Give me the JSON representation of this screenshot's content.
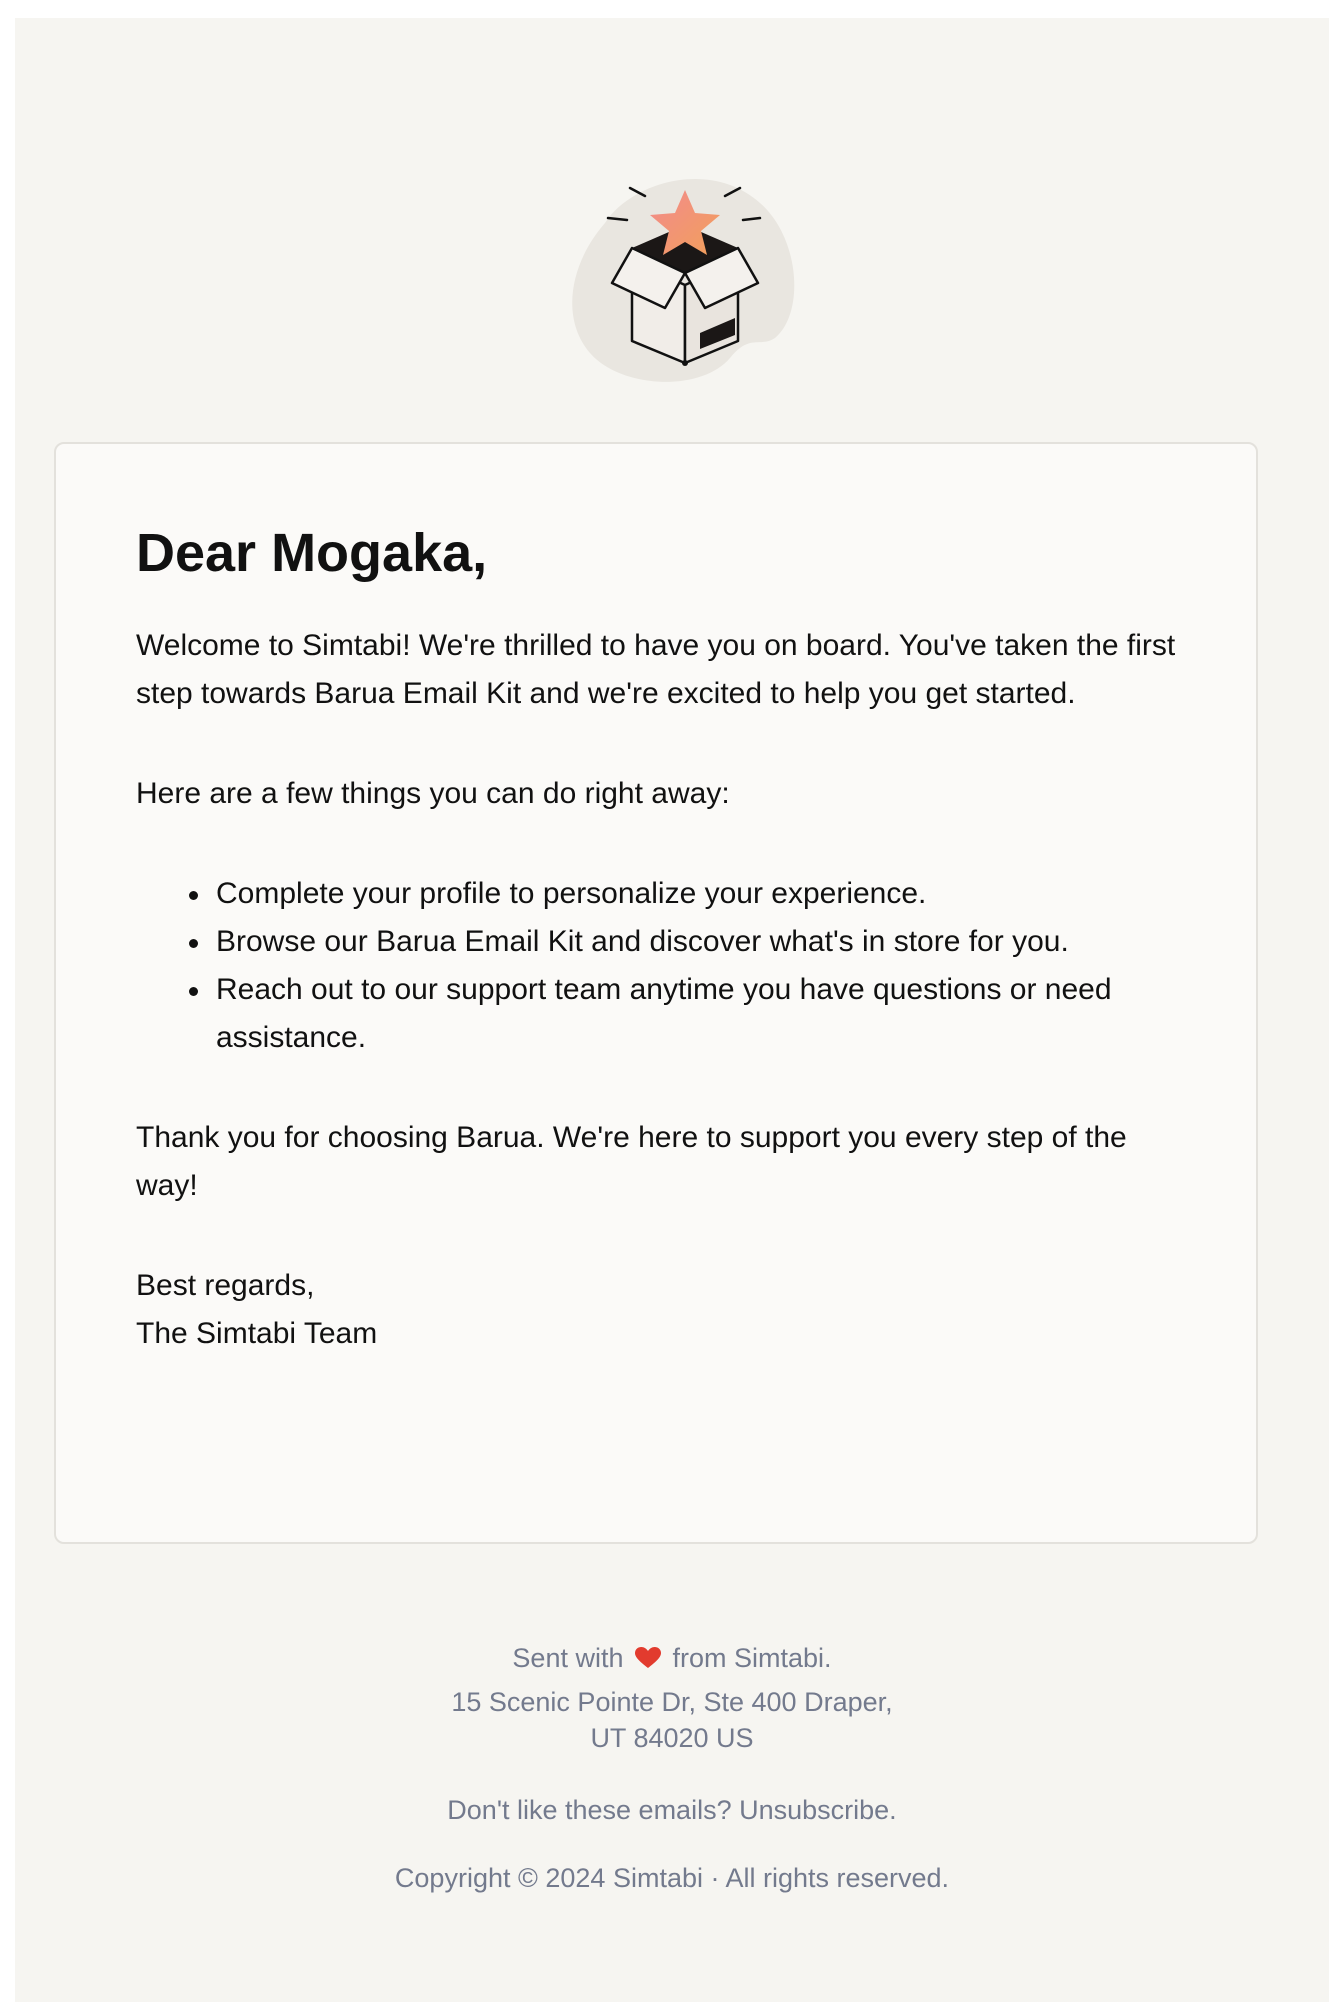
{
  "logo": {
    "icon": "open-box-with-star-icon",
    "accent_color": "#f08a78"
  },
  "email": {
    "greeting": "Dear Mogaka,",
    "intro": "Welcome to Simtabi! We're thrilled to have you on board. You've taken the first step towards Barua Email Kit and we're excited to help you get started.",
    "list_intro": "Here are a few things you can do right away:",
    "items": [
      {
        "text": "Complete your profile to personalize your experience."
      },
      {
        "text": "Browse our Barua Email Kit and discover what's in store for you."
      },
      {
        "text": "Reach out to our support team anytime you have questions or need assistance."
      }
    ],
    "closing": "Thank you for choosing Barua. We're here to support you every step of the way!",
    "regards": "Best regards,",
    "signature": "The Simtabi Team"
  },
  "footer": {
    "sent_prefix": "Sent with",
    "heart_icon": "heart-icon",
    "heart_color": "#e23b2e",
    "sent_suffix": "from Simtabi.",
    "address_line1": "15 Scenic Pointe Dr, Ste 400 Draper,",
    "address_line2": "UT 84020 US",
    "unsubscribe_prefix": "Don't like these emails?",
    "unsubscribe_link": "Unsubscribe.",
    "copyright": "Copyright © 2024 Simtabi · All rights reserved."
  },
  "colors": {
    "page_background": "#f6f5f1",
    "card_background": "#fbfaf8",
    "footer_text": "#737a8d"
  }
}
